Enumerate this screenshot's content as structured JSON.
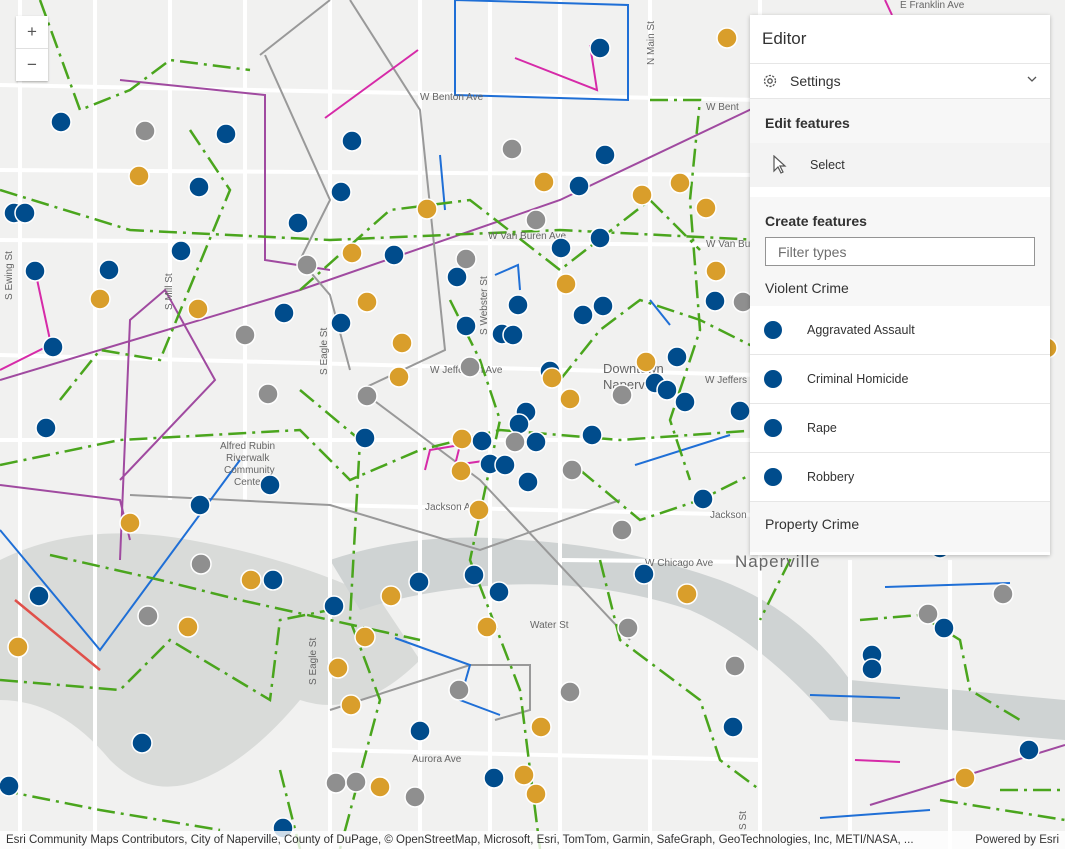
{
  "zoom": {
    "in_label": "+",
    "out_label": "−"
  },
  "map": {
    "labels": {
      "franklin": "E Franklin Ave",
      "benton_w": "W Benton Ave",
      "benton_e": "W Bent",
      "van_buren": "W Van Buren Ave",
      "van_buren_e": "W Van Bu",
      "jefferson": "W Jefferson Ave",
      "jefferson_e": "W Jeffers",
      "jackson": "Jackson Ave",
      "jackson_e": "Jackson",
      "chicago": "W Chicago Ave",
      "water": "Water St",
      "aurora": "Aurora Ave",
      "ewing": "S Ewing St",
      "mill": "S Mill St",
      "eagle_n": "S Eagle St",
      "eagle_s": "S Eagle St",
      "webster": "S Webster St",
      "main": "N Main St",
      "s_st": "S St",
      "downtown_1": "Downtown",
      "downtown_2": "Naperville",
      "alfred_1": "Alfred Rubin",
      "alfred_2": "Riverwalk",
      "alfred_3": "Community",
      "alfred_4": "Center",
      "naperville": "Naperville"
    },
    "colors": {
      "violent": "#004c8c",
      "property": "#d99e2b",
      "other": "#8f8f8f"
    }
  },
  "attribution": {
    "text": "Esri Community Maps Contributors, City of Naperville, County of DuPage, © OpenStreetMap, Microsoft, Esri, TomTom, Garmin, SafeGraph, GeoTechnologies, Inc, METI/NASA, ...",
    "powered": "Powered by Esri"
  },
  "editor": {
    "title": "Editor",
    "settings_label": "Settings",
    "edit_section": "Edit features",
    "select_label": "Select",
    "create_section": "Create features",
    "filter_placeholder": "Filter types",
    "group_violent": "Violent Crime",
    "types": [
      "Aggravated Assault",
      "Criminal Homicide",
      "Rape",
      "Robbery"
    ],
    "group_property": "Property Crime"
  }
}
